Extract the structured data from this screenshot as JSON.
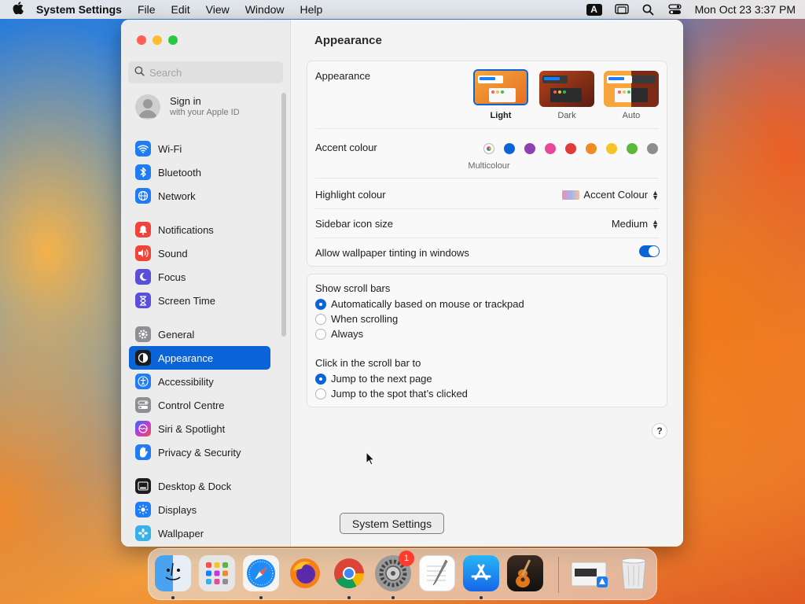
{
  "menubar": {
    "app_name": "System Settings",
    "items": [
      "File",
      "Edit",
      "View",
      "Window",
      "Help"
    ],
    "input_indicator": "A",
    "datetime": "Mon Oct 23  3:37 PM"
  },
  "sidebar": {
    "search_placeholder": "Search",
    "signin_title": "Sign in",
    "signin_subtitle": "with your Apple ID",
    "items": [
      {
        "label": "Wi-Fi",
        "icon": "wifi-icon",
        "color": "#1f7cf5"
      },
      {
        "label": "Bluetooth",
        "icon": "bluetooth-icon",
        "color": "#1f7cf5"
      },
      {
        "label": "Network",
        "icon": "globe-icon",
        "color": "#1f7cf5"
      },
      {
        "label": "Notifications",
        "icon": "bell-icon",
        "color": "#f0443a"
      },
      {
        "label": "Sound",
        "icon": "speaker-icon",
        "color": "#f0443a"
      },
      {
        "label": "Focus",
        "icon": "moon-icon",
        "color": "#5a4fd8"
      },
      {
        "label": "Screen Time",
        "icon": "hourglass-icon",
        "color": "#5a4fd8"
      },
      {
        "label": "General",
        "icon": "gear-icon",
        "color": "#8e8e93"
      },
      {
        "label": "Appearance",
        "icon": "appearance-icon",
        "color": "#1c1c1e"
      },
      {
        "label": "Accessibility",
        "icon": "accessibility-icon",
        "color": "#1f7cf5"
      },
      {
        "label": "Control Centre",
        "icon": "toggles-icon",
        "color": "#8e8e93"
      },
      {
        "label": "Siri & Spotlight",
        "icon": "siri-icon",
        "color": "#c23ad6"
      },
      {
        "label": "Privacy & Security",
        "icon": "hand-icon",
        "color": "#1f7cf5"
      },
      {
        "label": "Desktop & Dock",
        "icon": "dock-icon",
        "color": "#1c1c1e"
      },
      {
        "label": "Displays",
        "icon": "sun-icon",
        "color": "#1f7cf5"
      },
      {
        "label": "Wallpaper",
        "icon": "flower-icon",
        "color": "#3bb0e8"
      }
    ],
    "selected": "Appearance"
  },
  "content": {
    "title": "Appearance",
    "appearance_label": "Appearance",
    "appearance_options": [
      "Light",
      "Dark",
      "Auto"
    ],
    "appearance_selected": "Light",
    "accent_label": "Accent colour",
    "accent_selected_label": "Multicolour",
    "accent_colors": [
      "#0a64d8",
      "#8e3fb0",
      "#e8489c",
      "#e03a3a",
      "#f08a24",
      "#f6c427",
      "#5cb83b",
      "#8e8e8e"
    ],
    "highlight_label": "Highlight colour",
    "highlight_value": "Accent Colour",
    "icon_size_label": "Sidebar icon size",
    "icon_size_value": "Medium",
    "tinting_label": "Allow wallpaper tinting in windows",
    "tinting_on": true,
    "scroll_label": "Show scroll bars",
    "scroll_options": [
      "Automatically based on mouse or trackpad",
      "When scrolling",
      "Always"
    ],
    "scroll_selected": 0,
    "click_label": "Click in the scroll bar to",
    "click_options": [
      "Jump to the next page",
      "Jump to the spot that’s clicked"
    ],
    "click_selected": 0,
    "help_label": "?"
  },
  "tooltip": "System Settings",
  "dock": {
    "apps": [
      "Finder",
      "Launchpad",
      "Safari",
      "Firefox",
      "Chrome",
      "System Settings",
      "TextEdit",
      "App Store",
      "GarageBand"
    ],
    "settings_badge": "1"
  }
}
